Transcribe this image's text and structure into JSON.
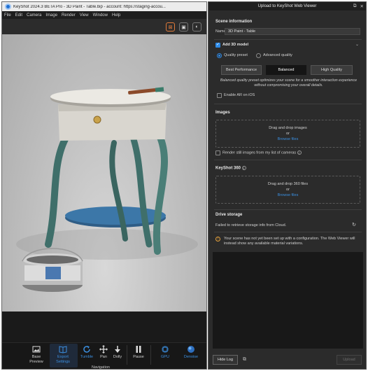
{
  "main_window": {
    "title": "KeyShot 2024.3 BETA Pro - 3D Paint - Table.bip - account: https://staging-accou...",
    "menu": [
      "File",
      "Edit",
      "Camera",
      "Image",
      "Render",
      "View",
      "Window",
      "Help"
    ]
  },
  "ribbon": {
    "buttons": [
      {
        "label": "Base Preview",
        "icon": "image-icon"
      },
      {
        "label": "Export Settings",
        "icon": "book-icon"
      },
      {
        "label": "Tumble",
        "icon": "refresh-icon"
      },
      {
        "label": "Pan",
        "icon": "move-icon"
      },
      {
        "label": "Dolly",
        "icon": "arrow-down-icon"
      },
      {
        "label": "Pause",
        "icon": "pause-icon"
      },
      {
        "label": "GPU",
        "icon": "chip-icon"
      },
      {
        "label": "Denoise",
        "icon": "sphere-icon"
      }
    ],
    "group_label": "Navigation"
  },
  "upload_panel": {
    "title": "Upload to KeyShot Web Viewer",
    "scene_information": {
      "heading": "Scene information",
      "name_label": "Name",
      "name_value": "3D Paint - Table"
    },
    "add_3d_model": {
      "label": "Add 3D model",
      "checked": true,
      "quality_preset_label": "Quality preset",
      "advanced_quality_label": "Advanced quality",
      "presets": [
        "Best Performance",
        "Balanced",
        "High Quality"
      ],
      "selected_preset": "Balanced",
      "hint": "Balanced quality preset optimizes your scene for a smoother interaction experience without compromising your overall details.",
      "enable_ar_label": "Enable AR on iOS"
    },
    "images": {
      "heading": "Images",
      "drop_text": "Drag and drop images",
      "or_text": "or",
      "browse_text": "Browse files",
      "render_still_label": "Render still images from my list of cameras"
    },
    "keyshot360": {
      "heading": "KeyShot 360",
      "drop_text": "Drag and drop 360 files",
      "or_text": "or",
      "browse_text": "Browse files"
    },
    "drive_storage": {
      "heading": "Drive storage",
      "error_text": "Failed to retrieve storage info from Cloud."
    },
    "warning_text": "Your scene has not yet been set up with a configuration. The Web Viewer will instead show any available material variations.",
    "hide_log_label": "Hide Log",
    "upload_label": "Upload"
  },
  "colors": {
    "accent": "#2e8ae6",
    "warning": "#e6a23c",
    "panel_bg": "#2b2b2b"
  }
}
